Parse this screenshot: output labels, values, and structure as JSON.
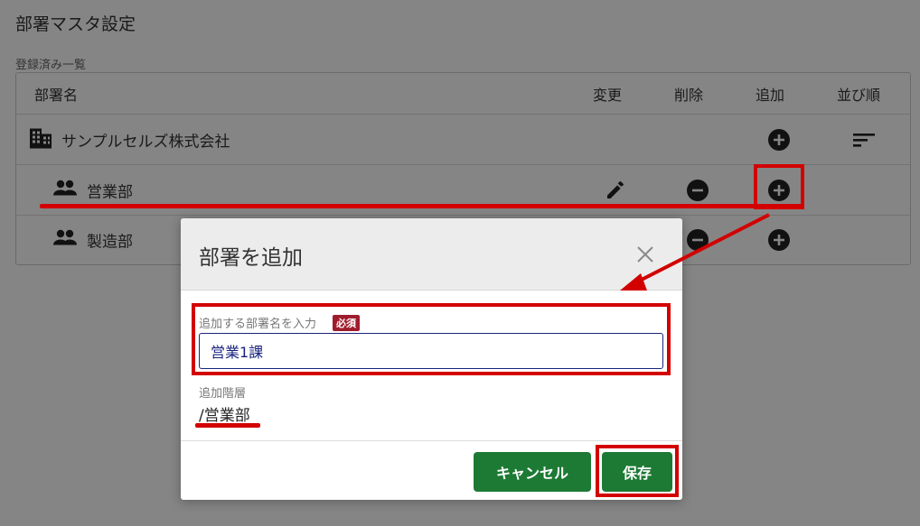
{
  "page": {
    "title": "部署マスタ設定",
    "section_label": "登録済み一覧"
  },
  "table": {
    "headers": {
      "name": "部署名",
      "change": "変更",
      "delete": "削除",
      "add": "追加",
      "order": "並び順"
    },
    "rows": [
      {
        "name": "サンプルセルズ株式会社",
        "icon": "building-icon"
      },
      {
        "name": "営業部",
        "icon": "group-icon"
      },
      {
        "name": "製造部",
        "icon": "group-icon"
      }
    ]
  },
  "dialog": {
    "title": "部署を追加",
    "field_label": "追加する部署名を入力",
    "required_badge": "必須",
    "input_value": "営業1課",
    "level_label": "追加階層",
    "level_value": "/営業部",
    "cancel_label": "キャンセル",
    "save_label": "保存"
  },
  "colors": {
    "primary_button": "#1d7a34",
    "annotation": "#d30000",
    "required_badge": "#9e1c2c",
    "input_border": "#1a237e"
  }
}
